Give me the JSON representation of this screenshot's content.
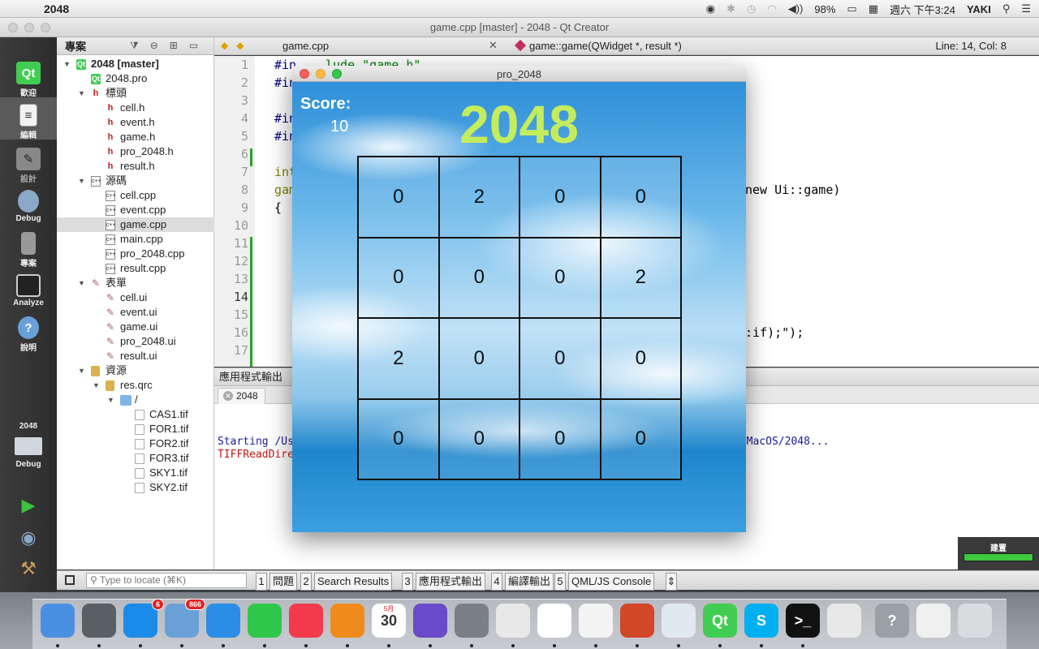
{
  "menubar": {
    "app": "2048",
    "battery": "98%",
    "clock": "週六 下午3:24",
    "user": "YAKI"
  },
  "window": {
    "title": "game.cpp [master] - 2048 - Qt Creator"
  },
  "modes": [
    {
      "label": "歡迎"
    },
    {
      "label": "編輯"
    },
    {
      "label": "設計"
    },
    {
      "label": "Debug"
    },
    {
      "label": "專案"
    },
    {
      "label": "Analyze"
    },
    {
      "label": "說明"
    }
  ],
  "kit": {
    "project": "2048",
    "mode": "Debug"
  },
  "project_panel": {
    "header": "專案",
    "tree": [
      {
        "label": "2048 [master]",
        "icon": "pro",
        "depth": 0,
        "expanded": true,
        "bold": true
      },
      {
        "label": "2048.pro",
        "icon": "pro",
        "depth": 1
      },
      {
        "label": "標頭",
        "icon": "h",
        "depth": 1,
        "expanded": true
      },
      {
        "label": "cell.h",
        "icon": "h",
        "depth": 2
      },
      {
        "label": "event.h",
        "icon": "h",
        "depth": 2
      },
      {
        "label": "game.h",
        "icon": "h",
        "depth": 2
      },
      {
        "label": "pro_2048.h",
        "icon": "h",
        "depth": 2
      },
      {
        "label": "result.h",
        "icon": "h",
        "depth": 2
      },
      {
        "label": "源碼",
        "icon": "cpp",
        "depth": 1,
        "expanded": true
      },
      {
        "label": "cell.cpp",
        "icon": "cpp",
        "depth": 2
      },
      {
        "label": "event.cpp",
        "icon": "cpp",
        "depth": 2
      },
      {
        "label": "game.cpp",
        "icon": "cpp",
        "depth": 2,
        "selected": true
      },
      {
        "label": "main.cpp",
        "icon": "cpp",
        "depth": 2
      },
      {
        "label": "pro_2048.cpp",
        "icon": "cpp",
        "depth": 2
      },
      {
        "label": "result.cpp",
        "icon": "cpp",
        "depth": 2
      },
      {
        "label": "表單",
        "icon": "ui",
        "depth": 1,
        "expanded": true
      },
      {
        "label": "cell.ui",
        "icon": "ui",
        "depth": 2
      },
      {
        "label": "event.ui",
        "icon": "ui",
        "depth": 2
      },
      {
        "label": "game.ui",
        "icon": "ui",
        "depth": 2
      },
      {
        "label": "pro_2048.ui",
        "icon": "ui",
        "depth": 2
      },
      {
        "label": "result.ui",
        "icon": "ui",
        "depth": 2
      },
      {
        "label": "資源",
        "icon": "lock",
        "depth": 1,
        "expanded": true
      },
      {
        "label": "res.qrc",
        "icon": "lock",
        "depth": 2,
        "expanded": true
      },
      {
        "label": "/",
        "icon": "folder",
        "depth": 3,
        "expanded": true
      },
      {
        "label": "CAS1.tif",
        "icon": "img",
        "depth": 4
      },
      {
        "label": "FOR1.tif",
        "icon": "img",
        "depth": 4
      },
      {
        "label": "FOR2.tif",
        "icon": "img",
        "depth": 4
      },
      {
        "label": "FOR3.tif",
        "icon": "img",
        "depth": 4
      },
      {
        "label": "SKY1.tif",
        "icon": "img",
        "depth": 4
      },
      {
        "label": "SKY2.tif",
        "icon": "img",
        "depth": 4
      }
    ]
  },
  "editor": {
    "file": "game.cpp",
    "function": "game::game(QWidget *, result *)",
    "cursor": "Line: 14, Col: 8",
    "line_numbers": [
      "1",
      "2",
      "3",
      "4",
      "5",
      "6",
      "7",
      "8",
      "9",
      "10",
      "11",
      "12",
      "13",
      "14",
      "15",
      "16",
      "17"
    ],
    "current_line": "14",
    "visible_code": [
      {
        "line": 1,
        "left": "#in",
        "right": "lude \"game.h\""
      },
      {
        "line": 2,
        "left": "#in",
        "right": ""
      },
      {
        "line": 4,
        "left": "#in",
        "right": ""
      },
      {
        "line": 5,
        "left": "#in",
        "right": ""
      },
      {
        "line": 7,
        "left": "int",
        "right": ""
      },
      {
        "line": 8,
        "left": "gam",
        "right": "new Ui::game)"
      },
      {
        "line": 9,
        "left": "{",
        "right": ""
      },
      {
        "line": 16,
        "left": "",
        "right": ":if);\");"
      }
    ]
  },
  "output": {
    "title": "應用程式輸出",
    "tab": "2048",
    "lines": [
      {
        "left": "Starting /Use",
        "right": "s/MacOS/2048...",
        "color": "blue"
      },
      {
        "left": "TIFFReadDirec",
        "right": "",
        "color": "red"
      }
    ]
  },
  "build": {
    "label": "建置"
  },
  "statusbar": {
    "locate_placeholder": "Type to locate (⌘K)",
    "panes": [
      {
        "num": "1",
        "label": "問題"
      },
      {
        "num": "2",
        "label": "Search Results"
      },
      {
        "num": "3",
        "label": "應用程式輸出"
      },
      {
        "num": "4",
        "label": "編譯輸出"
      },
      {
        "num": "5",
        "label": "QML/JS Console"
      }
    ]
  },
  "game": {
    "window_title": "pro_2048",
    "score_label": "Score:",
    "score": "10",
    "title": "2048",
    "board": [
      "0",
      "2",
      "0",
      "0",
      "0",
      "0",
      "0",
      "2",
      "2",
      "0",
      "0",
      "0",
      "0",
      "0",
      "0",
      "0"
    ]
  },
  "dock": [
    {
      "name": "finder-icon",
      "color": "#4a90e2"
    },
    {
      "name": "launchpad-icon",
      "color": "#5a5f66"
    },
    {
      "name": "app-store-icon",
      "color": "#1a8be8",
      "badge": "6"
    },
    {
      "name": "mail-icon",
      "color": "#6aa0d8",
      "badge": "866"
    },
    {
      "name": "safari-icon",
      "color": "#2b8de6"
    },
    {
      "name": "facetime-icon",
      "color": "#2fc84a"
    },
    {
      "name": "music-icon",
      "color": "#f23a4a"
    },
    {
      "name": "ibooks-icon",
      "color": "#f08a1a"
    },
    {
      "name": "calendar-icon",
      "color": "#ffffff",
      "text": "30",
      "month": "5月"
    },
    {
      "name": "quill-icon",
      "color": "#6a4ac8"
    },
    {
      "name": "system-preferences-icon",
      "color": "#7a7f86"
    },
    {
      "name": "preview-icon",
      "color": "#e8e8e8"
    },
    {
      "name": "photos-icon",
      "color": "#ffffff"
    },
    {
      "name": "acrobat-icon",
      "color": "#f4f4f4"
    },
    {
      "name": "powerpoint-icon",
      "color": "#d24726"
    },
    {
      "name": "matlab-icon",
      "color": "#e0e8f0"
    },
    {
      "name": "qt-creator-icon",
      "color": "#41cd52",
      "text": "Qt"
    },
    {
      "name": "skype-icon",
      "color": "#00aff0",
      "text": "S"
    },
    {
      "name": "terminal-icon",
      "color": "#111111",
      "text": ">_"
    },
    {
      "name": "xcode-icon",
      "color": "#e8e8e8"
    },
    {
      "name": "help-icon",
      "color": "#9aa0a8",
      "text": "?"
    },
    {
      "name": "documents-icon",
      "color": "#f0f0f0"
    },
    {
      "name": "trash-icon",
      "color": "#d8dcdf"
    }
  ]
}
